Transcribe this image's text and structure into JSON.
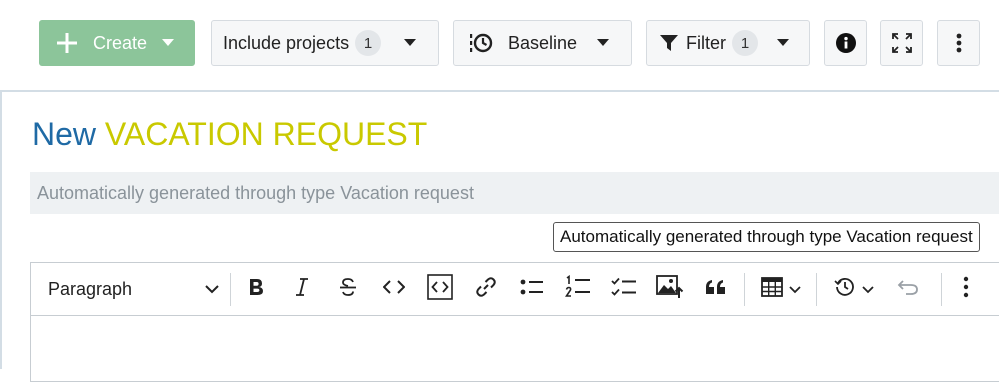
{
  "toolbar": {
    "create_label": "Create",
    "include_projects_label": "Include projects",
    "include_projects_count": "1",
    "baseline_label": "Baseline",
    "filter_label": "Filter",
    "filter_count": "1",
    "colors": {
      "create_bg": "#8cc59a",
      "button_bg": "#f6f7f8"
    }
  },
  "work_package": {
    "title_prefix": "New",
    "type_name": "VACATION REQUEST",
    "description_placeholder": "Automatically generated through type Vacation request",
    "tooltip": "Automatically generated through type Vacation request",
    "colors": {
      "title_prefix": "#1f6aa5",
      "type_name": "#c9c900"
    }
  },
  "editor": {
    "paragraph_style": "Paragraph",
    "tools": [
      "bold-icon",
      "italic-icon",
      "strikethrough-icon",
      "code-icon",
      "code-block-icon",
      "link-icon",
      "bulleted-list-icon",
      "numbered-list-icon",
      "todo-list-icon",
      "insert-image-icon",
      "blockquote-icon",
      "table-icon",
      "history-icon",
      "undo-icon",
      "more-icon"
    ]
  }
}
